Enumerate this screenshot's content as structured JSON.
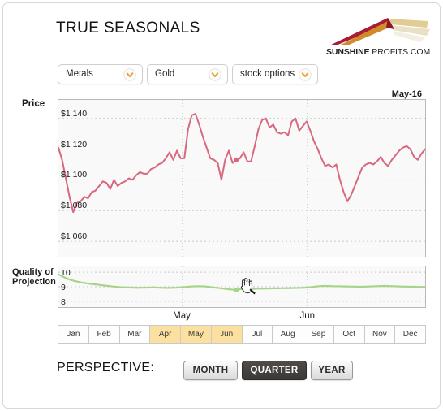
{
  "header": {
    "title": "TRUE SEASONALS",
    "logo": {
      "name_bold": "SUNSHINE",
      "name_rest": " PROFITS.COM",
      "colors": [
        "#a81d35",
        "#d9972a",
        "#efe3c2"
      ]
    }
  },
  "selectors": [
    {
      "id": "category",
      "value": "Metals",
      "icon": "chevron-down-icon"
    },
    {
      "id": "asset",
      "value": "Gold",
      "icon": "chevron-down-icon"
    },
    {
      "id": "type",
      "value": "stock options",
      "icon": "chevron-down-icon"
    }
  ],
  "price_panel": {
    "label": "Price",
    "date_label": "May-16"
  },
  "quality_panel": {
    "label_line1": "Quality of",
    "label_line2": "Projection"
  },
  "month_strip": {
    "months": [
      "Jan",
      "Feb",
      "Mar",
      "Apr",
      "May",
      "Jun",
      "Jul",
      "Aug",
      "Sep",
      "Oct",
      "Nov",
      "Dec"
    ],
    "selected": [
      "Apr",
      "May",
      "Jun"
    ],
    "highlight_color": "#fbe0a0"
  },
  "perspective": {
    "label": "PERSPECTIVE:",
    "options": [
      "MONTH",
      "QUARTER",
      "YEAR"
    ],
    "selected": "QUARTER"
  },
  "cursor": {
    "icon": "grab-hand-cursor-icon"
  },
  "chart_data": [
    {
      "id": "price",
      "type": "line",
      "title": "Price",
      "ylabel": "Price",
      "xlabel": "",
      "ylim": [
        1050,
        1152
      ],
      "yticks": [
        1140,
        1120,
        1100,
        1080,
        1060
      ],
      "ytick_labels": [
        "$1 140",
        "$1 120",
        "$1 100",
        "$1 080",
        "$1 060"
      ],
      "grid": true,
      "line_color": "#d8687e",
      "annotation": "May-16",
      "vlines": [
        "May",
        "Jun"
      ],
      "marker_point": {
        "x_index": 48,
        "y": 1113
      },
      "values": [
        1121,
        1113,
        1101,
        1089,
        1079,
        1085,
        1086,
        1089,
        1088,
        1092,
        1093,
        1096,
        1099,
        1098,
        1094,
        1100,
        1096,
        1098,
        1099,
        1101,
        1100,
        1103,
        1105,
        1104,
        1104,
        1107,
        1108,
        1110,
        1111,
        1114,
        1118,
        1113,
        1119,
        1114,
        1114,
        1133,
        1142,
        1143,
        1136,
        1128,
        1121,
        1114,
        1113,
        1111,
        1100,
        1113,
        1119,
        1111,
        1113,
        1114,
        1118,
        1112,
        1112,
        1122,
        1133,
        1139,
        1140,
        1134,
        1136,
        1131,
        1130,
        1131,
        1129,
        1138,
        1140,
        1132,
        1135,
        1138,
        1132,
        1125,
        1120,
        1114,
        1109,
        1110,
        1108,
        1110,
        1100,
        1092,
        1086,
        1090,
        1096,
        1102,
        1108,
        1110,
        1111,
        1110,
        1112,
        1115,
        1111,
        1109,
        1113,
        1116,
        1119,
        1121,
        1122,
        1120,
        1115,
        1113,
        1117,
        1120
      ]
    },
    {
      "id": "quality_of_projection",
      "type": "line",
      "title": "Quality of Projection",
      "ylabel": "Quality of Projection",
      "xlabel": "",
      "ylim": [
        7.6,
        10.4
      ],
      "yticks": [
        10,
        9,
        8
      ],
      "ytick_labels": [
        "10",
        "9",
        "8"
      ],
      "grid": true,
      "line_color": "#a8d38a",
      "vlines": [
        "May",
        "Jun"
      ],
      "marker_point": {
        "x_index": 48,
        "y": 8.78
      },
      "values": [
        9.85,
        9.72,
        9.6,
        9.5,
        9.42,
        9.36,
        9.3,
        9.26,
        9.22,
        9.19,
        9.16,
        9.13,
        9.1,
        9.07,
        9.04,
        9.01,
        8.99,
        8.97,
        8.96,
        8.95,
        8.94,
        8.93,
        8.93,
        8.94,
        8.94,
        8.95,
        8.95,
        8.94,
        8.93,
        8.92,
        8.92,
        8.93,
        8.94,
        8.96,
        8.98,
        9.0,
        9.02,
        9.03,
        9.04,
        9.03,
        9.01,
        8.98,
        8.95,
        8.92,
        8.89,
        8.86,
        8.83,
        8.8,
        8.78,
        8.83,
        8.85,
        8.84,
        8.85,
        8.86,
        8.87,
        8.87,
        8.88,
        8.88,
        8.89,
        8.89,
        8.9,
        8.9,
        8.91,
        8.91,
        8.92,
        8.92,
        8.93,
        8.95,
        8.97,
        9.0,
        9.03,
        9.05,
        9.06,
        9.05,
        9.04,
        9.03,
        9.03,
        9.02,
        9.02,
        9.01,
        9.01,
        9.0,
        9.0,
        9.01,
        9.02,
        9.03,
        9.04,
        9.05,
        9.06,
        9.05,
        9.04,
        9.03,
        9.02,
        9.01,
        9.01,
        9.0,
        9.0,
        8.99,
        8.99,
        8.99
      ]
    }
  ],
  "axis_month_ticks": [
    {
      "label": "May",
      "x_frac": 0.337
    },
    {
      "label": "Jun",
      "x_frac": 0.678
    }
  ]
}
